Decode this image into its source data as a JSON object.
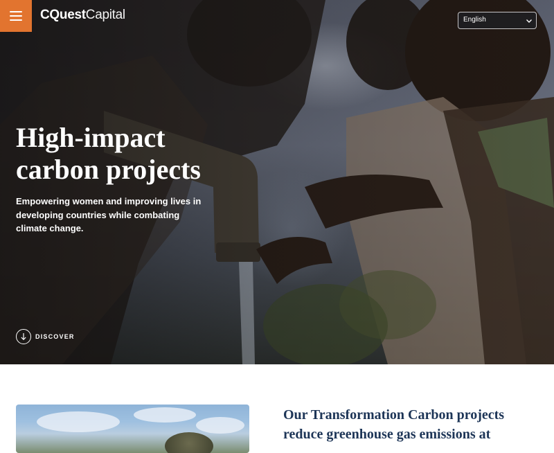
{
  "header": {
    "brand_bold": "CQuest",
    "brand_light": "Capital",
    "language": {
      "selected": "English"
    }
  },
  "hero": {
    "title": "High-impact carbon projects",
    "subtitle": "Empowering women and improving lives in developing countries while combating climate change.",
    "discover_label": "DISCOVER"
  },
  "intro": {
    "heading": "Our Transformation Carbon projects reduce greenhouse gas emissions at"
  },
  "colors": {
    "accent": "#e2742f",
    "heading": "#1d3557"
  },
  "icons": {
    "menu": "hamburger-icon",
    "language": "chevron-down-icon",
    "discover": "arrow-down-icon"
  }
}
